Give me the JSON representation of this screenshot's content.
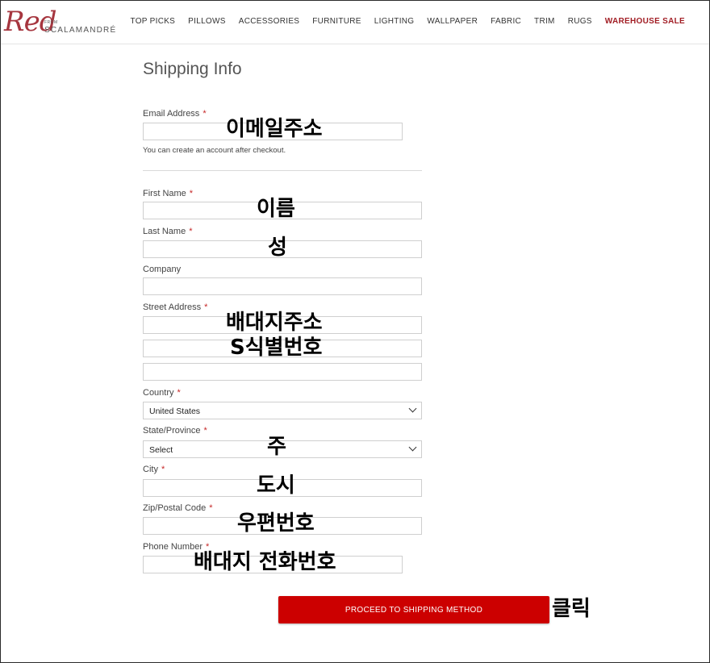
{
  "brand": {
    "script": "Red",
    "from": "FROM",
    "name": "SCALAMANDRÉ"
  },
  "nav": [
    "TOP PICKS",
    "PILLOWS",
    "ACCESSORIES",
    "FURNITURE",
    "LIGHTING",
    "WALLPAPER",
    "FABRIC",
    "TRIM",
    "RUGS"
  ],
  "nav_sale": "WAREHOUSE SALE",
  "form": {
    "title": "Shipping Info",
    "email_label": "Email Address",
    "email_help": "You can create an account after checkout.",
    "first_name_label": "First Name",
    "last_name_label": "Last Name",
    "company_label": "Company",
    "street_label": "Street Address",
    "country_label": "Country",
    "country_value": "United States",
    "state_label": "State/Province",
    "state_value": "Select",
    "city_label": "City",
    "zip_label": "Zip/Postal Code",
    "phone_label": "Phone Number",
    "submit_label": "PROCEED TO SHIPPING METHOD",
    "required_mark": "*"
  },
  "annotations": {
    "email": "이메일주소",
    "first_name": "이름",
    "last_name": "성",
    "street1": "배대지주소",
    "street2": "S식별번호",
    "state": "주",
    "city": "도시",
    "zip": "우편번호",
    "phone": "배대지 전화번호",
    "click": "클릭"
  },
  "colors": {
    "accent": "#cc0000",
    "sale": "#a11d24",
    "required": "#c62828"
  }
}
